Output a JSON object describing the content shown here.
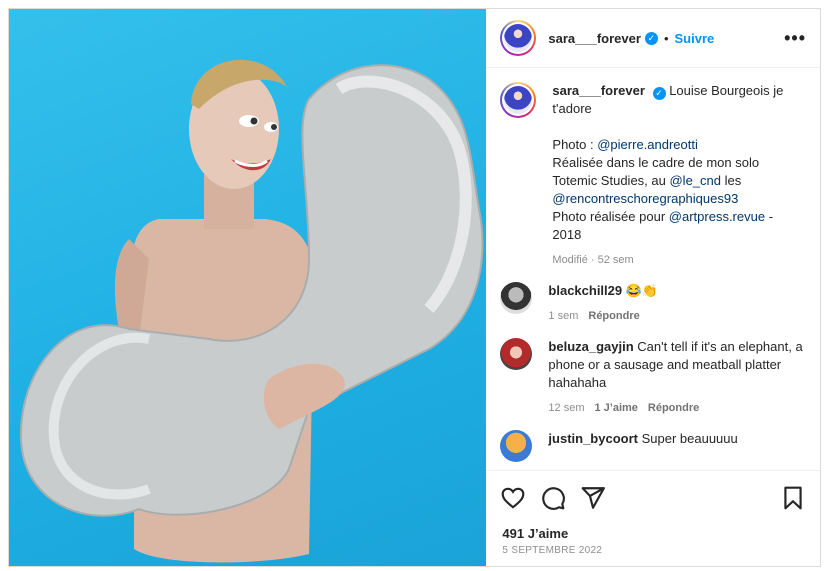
{
  "post": {
    "username": "sara___forever",
    "follow_label": "Suivre",
    "more_label": "•••",
    "caption_lines": [
      "Louise Bourgeois je t'adore"
    ],
    "credit": {
      "photo_label": "Photo :",
      "photo_link": "@pierre.andreotti",
      "line1": "Réalisée dans le cadre de mon solo",
      "line2a": "Totemic Studies, au",
      "line2_link": "@le_cnd",
      "line2b": "les",
      "line3_link": "@rencontreschoregraphiques93",
      "line4a": "Photo réalisée pour",
      "line4_link": "@artpress.revue",
      "line4b": "-",
      "line5": "2018"
    },
    "caption_meta": "Modifié · 52 sem",
    "likes": "491 J’aime",
    "date": "5 SEPTEMBRE 2022"
  },
  "comments": [
    {
      "username": "blackchill29",
      "text": "😂👏",
      "time": "1 sem",
      "likes": "",
      "reply_label": "Répondre"
    },
    {
      "username": "beluza_gayjin",
      "text": "Can't tell if it's an elephant, a phone or a sausage and meatball platter hahahaha",
      "time": "12 sem",
      "likes": "1 J’aime",
      "reply_label": "Répondre"
    },
    {
      "username": "justin_bycoort",
      "text": "Super beauuuuu"
    }
  ],
  "icons": [
    "heart-icon",
    "comment-icon",
    "share-icon",
    "bookmark-icon",
    "verified-icon"
  ],
  "colors": {
    "accent": "#0095f6",
    "background_photo": "#29b9e8",
    "text": "#262626",
    "muted": "#8e8e8e"
  }
}
